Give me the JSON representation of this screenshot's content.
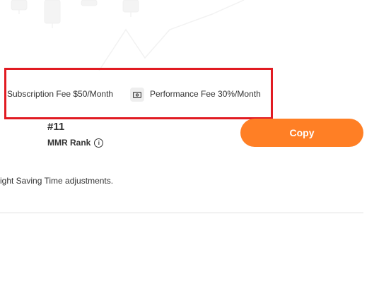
{
  "fees": {
    "subscription": "Subscription Fee $50/Month",
    "performance": "Performance Fee 30%/Month",
    "icon": "money-icon"
  },
  "rank": {
    "value": "#11",
    "label": "MMR Rank",
    "info_icon": "i"
  },
  "copy_button": {
    "label": "Copy",
    "color": "#ff7f25"
  },
  "note": "ight Saving Time adjustments.",
  "colors": {
    "highlight_border": "#e11b22",
    "text": "#333333",
    "divider": "#e0e0e0"
  }
}
